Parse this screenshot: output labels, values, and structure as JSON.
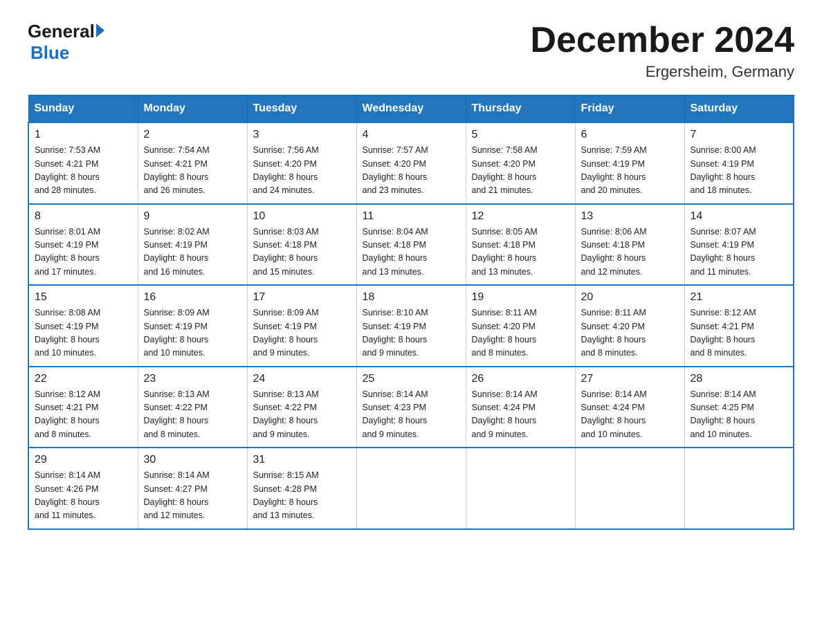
{
  "header": {
    "logo_general": "General",
    "logo_blue": "Blue",
    "month_title": "December 2024",
    "location": "Ergersheim, Germany"
  },
  "days_of_week": [
    "Sunday",
    "Monday",
    "Tuesday",
    "Wednesday",
    "Thursday",
    "Friday",
    "Saturday"
  ],
  "weeks": [
    [
      {
        "day": "1",
        "sunrise": "7:53 AM",
        "sunset": "4:21 PM",
        "daylight": "8 hours and 28 minutes."
      },
      {
        "day": "2",
        "sunrise": "7:54 AM",
        "sunset": "4:21 PM",
        "daylight": "8 hours and 26 minutes."
      },
      {
        "day": "3",
        "sunrise": "7:56 AM",
        "sunset": "4:20 PM",
        "daylight": "8 hours and 24 minutes."
      },
      {
        "day": "4",
        "sunrise": "7:57 AM",
        "sunset": "4:20 PM",
        "daylight": "8 hours and 23 minutes."
      },
      {
        "day": "5",
        "sunrise": "7:58 AM",
        "sunset": "4:20 PM",
        "daylight": "8 hours and 21 minutes."
      },
      {
        "day": "6",
        "sunrise": "7:59 AM",
        "sunset": "4:19 PM",
        "daylight": "8 hours and 20 minutes."
      },
      {
        "day": "7",
        "sunrise": "8:00 AM",
        "sunset": "4:19 PM",
        "daylight": "8 hours and 18 minutes."
      }
    ],
    [
      {
        "day": "8",
        "sunrise": "8:01 AM",
        "sunset": "4:19 PM",
        "daylight": "8 hours and 17 minutes."
      },
      {
        "day": "9",
        "sunrise": "8:02 AM",
        "sunset": "4:19 PM",
        "daylight": "8 hours and 16 minutes."
      },
      {
        "day": "10",
        "sunrise": "8:03 AM",
        "sunset": "4:18 PM",
        "daylight": "8 hours and 15 minutes."
      },
      {
        "day": "11",
        "sunrise": "8:04 AM",
        "sunset": "4:18 PM",
        "daylight": "8 hours and 13 minutes."
      },
      {
        "day": "12",
        "sunrise": "8:05 AM",
        "sunset": "4:18 PM",
        "daylight": "8 hours and 13 minutes."
      },
      {
        "day": "13",
        "sunrise": "8:06 AM",
        "sunset": "4:18 PM",
        "daylight": "8 hours and 12 minutes."
      },
      {
        "day": "14",
        "sunrise": "8:07 AM",
        "sunset": "4:19 PM",
        "daylight": "8 hours and 11 minutes."
      }
    ],
    [
      {
        "day": "15",
        "sunrise": "8:08 AM",
        "sunset": "4:19 PM",
        "daylight": "8 hours and 10 minutes."
      },
      {
        "day": "16",
        "sunrise": "8:09 AM",
        "sunset": "4:19 PM",
        "daylight": "8 hours and 10 minutes."
      },
      {
        "day": "17",
        "sunrise": "8:09 AM",
        "sunset": "4:19 PM",
        "daylight": "8 hours and 9 minutes."
      },
      {
        "day": "18",
        "sunrise": "8:10 AM",
        "sunset": "4:19 PM",
        "daylight": "8 hours and 9 minutes."
      },
      {
        "day": "19",
        "sunrise": "8:11 AM",
        "sunset": "4:20 PM",
        "daylight": "8 hours and 8 minutes."
      },
      {
        "day": "20",
        "sunrise": "8:11 AM",
        "sunset": "4:20 PM",
        "daylight": "8 hours and 8 minutes."
      },
      {
        "day": "21",
        "sunrise": "8:12 AM",
        "sunset": "4:21 PM",
        "daylight": "8 hours and 8 minutes."
      }
    ],
    [
      {
        "day": "22",
        "sunrise": "8:12 AM",
        "sunset": "4:21 PM",
        "daylight": "8 hours and 8 minutes."
      },
      {
        "day": "23",
        "sunrise": "8:13 AM",
        "sunset": "4:22 PM",
        "daylight": "8 hours and 8 minutes."
      },
      {
        "day": "24",
        "sunrise": "8:13 AM",
        "sunset": "4:22 PM",
        "daylight": "8 hours and 9 minutes."
      },
      {
        "day": "25",
        "sunrise": "8:14 AM",
        "sunset": "4:23 PM",
        "daylight": "8 hours and 9 minutes."
      },
      {
        "day": "26",
        "sunrise": "8:14 AM",
        "sunset": "4:24 PM",
        "daylight": "8 hours and 9 minutes."
      },
      {
        "day": "27",
        "sunrise": "8:14 AM",
        "sunset": "4:24 PM",
        "daylight": "8 hours and 10 minutes."
      },
      {
        "day": "28",
        "sunrise": "8:14 AM",
        "sunset": "4:25 PM",
        "daylight": "8 hours and 10 minutes."
      }
    ],
    [
      {
        "day": "29",
        "sunrise": "8:14 AM",
        "sunset": "4:26 PM",
        "daylight": "8 hours and 11 minutes."
      },
      {
        "day": "30",
        "sunrise": "8:14 AM",
        "sunset": "4:27 PM",
        "daylight": "8 hours and 12 minutes."
      },
      {
        "day": "31",
        "sunrise": "8:15 AM",
        "sunset": "4:28 PM",
        "daylight": "8 hours and 13 minutes."
      },
      null,
      null,
      null,
      null
    ]
  ]
}
